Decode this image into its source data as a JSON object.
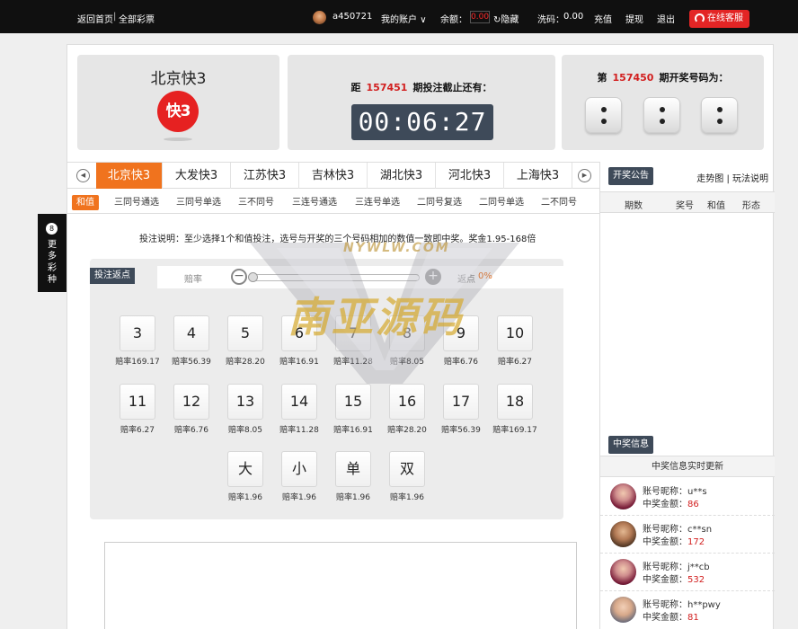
{
  "topbar": {
    "home": "返回首页",
    "sep": "|",
    "all_lottery": "全部彩票",
    "username": "a450721",
    "my_account": "我的账户",
    "balance_label": "余额：",
    "balance_value": "0.00",
    "hide": "隐藏",
    "wash_label": "洗码：",
    "wash_value": "0.00",
    "recharge": "充值",
    "withdraw": "提现",
    "logout": "退出",
    "service": "在线客服"
  },
  "game": {
    "name": "北京快3",
    "logo_text": "快3"
  },
  "countdown": {
    "prefix": "距",
    "issue": "157451",
    "suffix": "期投注截止还有：",
    "time": "00:06:27"
  },
  "result": {
    "prefix": "第",
    "issue": "157450",
    "suffix": "期开奖号码为："
  },
  "tabs": [
    "北京快3",
    "大发快3",
    "江苏快3",
    "吉林快3",
    "湖北快3",
    "河北快3",
    "上海快3"
  ],
  "subtabs": [
    "和值",
    "三同号通选",
    "三同号单选",
    "三不同号",
    "三连号通选",
    "三连号单选",
    "二同号复选",
    "二同号单选",
    "二不同号"
  ],
  "side_tab": {
    "ball": "8",
    "label": "更多彩种"
  },
  "instruction": "投注说明：至少选择1个和值投注，选号与开奖的三个号码相加的数值一致即中奖。奖金1.95-168倍",
  "rebate": {
    "tag": "投注返点",
    "odds_label": "赔率",
    "minus": "−",
    "plus": "+",
    "rebate_label": "返点",
    "rebate_value": "0%"
  },
  "bets": [
    {
      "n": "3",
      "odds": "赔率169.17"
    },
    {
      "n": "4",
      "odds": "赔率56.39"
    },
    {
      "n": "5",
      "odds": "赔率28.20"
    },
    {
      "n": "6",
      "odds": "赔率16.91"
    },
    {
      "n": "7",
      "odds": "赔率11.28"
    },
    {
      "n": "8",
      "odds": "赔率8.05"
    },
    {
      "n": "9",
      "odds": "赔率6.76"
    },
    {
      "n": "10",
      "odds": "赔率6.27"
    },
    {
      "n": "11",
      "odds": "赔率6.27"
    },
    {
      "n": "12",
      "odds": "赔率6.76"
    },
    {
      "n": "13",
      "odds": "赔率8.05"
    },
    {
      "n": "14",
      "odds": "赔率11.28"
    },
    {
      "n": "15",
      "odds": "赔率16.91"
    },
    {
      "n": "16",
      "odds": "赔率28.20"
    },
    {
      "n": "17",
      "odds": "赔率56.39"
    },
    {
      "n": "18",
      "odds": "赔率169.17"
    },
    {
      "n": "大",
      "odds": "赔率1.96"
    },
    {
      "n": "小",
      "odds": "赔率1.96"
    },
    {
      "n": "单",
      "odds": "赔率1.96"
    },
    {
      "n": "双",
      "odds": "赔率1.96"
    }
  ],
  "right": {
    "notice_tag": "开奖公告",
    "links": "走势图 | 玩法说明",
    "cols": [
      "期数",
      "奖号",
      "和值",
      "形态"
    ],
    "win_tag": "中奖信息",
    "realtime": "中奖信息实时更新",
    "nick_label": "账号昵称：",
    "amount_label": "中奖金额：",
    "winners": [
      {
        "nick": "u**s",
        "amount": "86"
      },
      {
        "nick": "c**sn",
        "amount": "172"
      },
      {
        "nick": "j**cb",
        "amount": "532"
      },
      {
        "nick": "h**pwy",
        "amount": "81"
      }
    ]
  },
  "watermark": {
    "title": "南亚源码",
    "small": "NYWLW.COM"
  },
  "colors": {
    "accent": "#f0731e",
    "dark": "#3e4a59",
    "red": "#d21f1f",
    "service": "#e32525"
  }
}
